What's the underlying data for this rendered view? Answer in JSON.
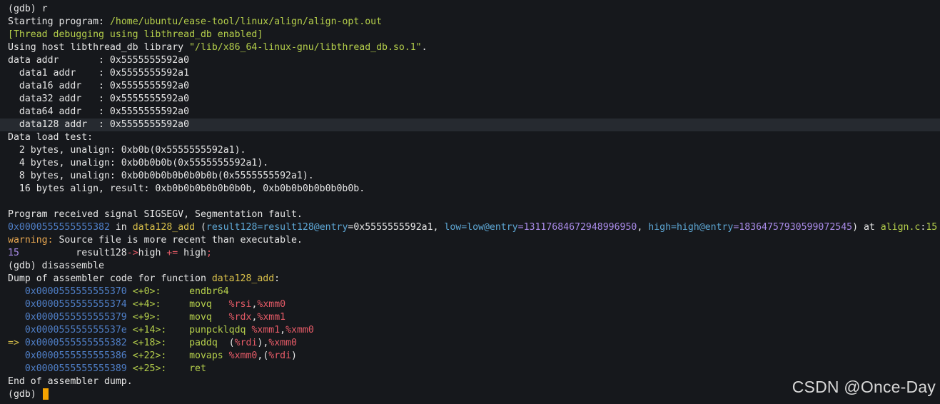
{
  "terminal": {
    "prompt": "(gdb)",
    "lines": {
      "partial_top": "",
      "run_cmd": "r",
      "starting_label": "Starting program:",
      "starting_path": "/home/ubuntu/ease-tool/linux/align/align-opt.out",
      "thread_debugging": "[Thread debugging using libthread_db enabled]",
      "host_prefix": "Using host libthread_db library ",
      "host_path": "\"/lib/x86_64-linux-gnu/libthread_db.so.1\"",
      "host_suffix": ".",
      "addr_data": "data addr       : 0x5555555592a0",
      "addr_data1": "  data1 addr    : 0x5555555592a1",
      "addr_data16": "  data16 addr   : 0x5555555592a0",
      "addr_data32": "  data32 addr   : 0x5555555592a0",
      "addr_data64": "  data64 addr   : 0x5555555592a0",
      "addr_data128": "  data128 addr  : 0x5555555592a0",
      "load_test": "Data load test:",
      "load_2": "  2 bytes, unalign: 0xb0b(0x5555555592a1).",
      "load_4": "  4 bytes, unalign: 0xb0b0b0b(0x5555555592a1).",
      "load_8": "  8 bytes, unalign: 0xb0b0b0b0b0b0b0b(0x5555555592a1).",
      "load_16": "  16 bytes align, result: 0xb0b0b0b0b0b0b0b, 0xb0b0b0b0b0b0b0b.",
      "signal": "Program received signal SIGSEGV, Segmentation fault.",
      "frame_addr": "0x0000555555555382",
      "frame_in": " in ",
      "frame_func": "data128_add",
      "frame_args_open": " (",
      "frame_arg1_name": "result128=result128@entry",
      "frame_arg1_val": "=0x5555555592a1, ",
      "frame_arg2_name": "low=low@entry",
      "frame_arg2_val": "=13117684672948996950",
      "frame_arg2_sep": ", ",
      "frame_arg3_name": "high=high@entry",
      "frame_arg3_val": "=18364757930599072545",
      "frame_args_close": ") at ",
      "frame_file": "align.c",
      "frame_colon": ":",
      "frame_line": "15",
      "warning_label": "warning:",
      "warning_text": " Source file is more recent than executable.",
      "src_lineno": "15",
      "src_code_a": "          result128",
      "src_arrow": "->",
      "src_code_b": "high ",
      "src_op": "+=",
      "src_code_c": " high",
      "src_semi": ";",
      "disassemble_cmd": "disassemble",
      "dump_prefix": "Dump of assembler code for function ",
      "dump_func": "data128_add",
      "dump_suffix": ":",
      "end_dump": "End of assembler dump."
    },
    "asm": [
      {
        "marker": "   ",
        "addr": "0x0000555555555370",
        "offset": " <+0>:",
        "pad": "     ",
        "mnemonic": "endbr64",
        "operands": []
      },
      {
        "marker": "   ",
        "addr": "0x0000555555555374",
        "offset": " <+4>:",
        "pad": "     ",
        "mnemonic": "movq   ",
        "operands": [
          "%rsi",
          ",",
          "%xmm0"
        ]
      },
      {
        "marker": "   ",
        "addr": "0x0000555555555379",
        "offset": " <+9>:",
        "pad": "     ",
        "mnemonic": "movq   ",
        "operands": [
          "%rdx",
          ",",
          "%xmm1"
        ]
      },
      {
        "marker": "   ",
        "addr": "0x000055555555537e",
        "offset": " <+14>:",
        "pad": "    ",
        "mnemonic": "punpcklqdq ",
        "operands": [
          "%xmm1",
          ",",
          "%xmm0"
        ]
      },
      {
        "marker": "=> ",
        "addr": "0x0000555555555382",
        "offset": " <+18>:",
        "pad": "    ",
        "mnemonic": "paddq  ",
        "operands": [
          "(",
          "%rdi",
          "),",
          "%xmm0"
        ]
      },
      {
        "marker": "   ",
        "addr": "0x0000555555555386",
        "offset": " <+22>:",
        "pad": "    ",
        "mnemonic": "movaps ",
        "operands": [
          "%xmm0",
          ",(",
          "%rdi",
          ")"
        ]
      },
      {
        "marker": "   ",
        "addr": "0x0000555555555389",
        "offset": " <+25>:",
        "pad": "    ",
        "mnemonic": "ret",
        "operands": []
      }
    ]
  },
  "watermark": "CSDN @Once-Day",
  "colors": {
    "background": "#16181c",
    "highlight_row": "#262a30",
    "cursor": "#f4a300",
    "green": "#b5cf4b",
    "yellow": "#d9c04a",
    "blue": "#4f7fc8",
    "purple": "#a98be8",
    "red": "#e65b67",
    "orange": "#e7a650"
  }
}
